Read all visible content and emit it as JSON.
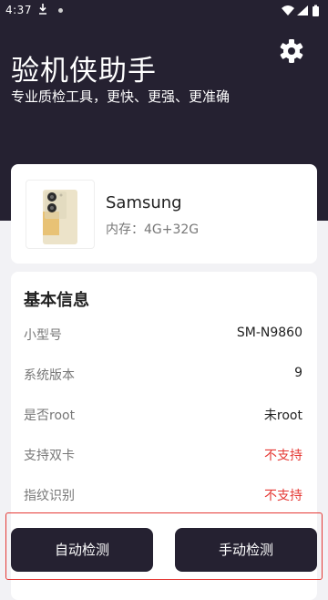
{
  "status_bar": {
    "time": "4:37"
  },
  "header": {
    "title": "验机侠助手",
    "subtitle": "专业质检工具，更快、更强、更准确"
  },
  "device": {
    "brand": "Samsung",
    "memory": "内存：4G+32G"
  },
  "basic_info": {
    "title": "基本信息",
    "rows": [
      {
        "label": "小型号",
        "value": "SM-N9860"
      },
      {
        "label": "系统版本",
        "value": "9"
      },
      {
        "label": "是否root",
        "value": "未root"
      },
      {
        "label": "支持双卡",
        "value": "不支持"
      },
      {
        "label": "指纹识别",
        "value": "不支持"
      }
    ]
  },
  "actions": {
    "auto_label": "自动检测",
    "manual_label": "手动检测"
  },
  "colors": {
    "header_bg": "#252131",
    "accent_red": "#e53935",
    "page_bg": "#f2f2f5"
  },
  "icons": [
    "download-icon",
    "wifi-icon",
    "signal-icon",
    "battery-icon",
    "gear-icon"
  ]
}
